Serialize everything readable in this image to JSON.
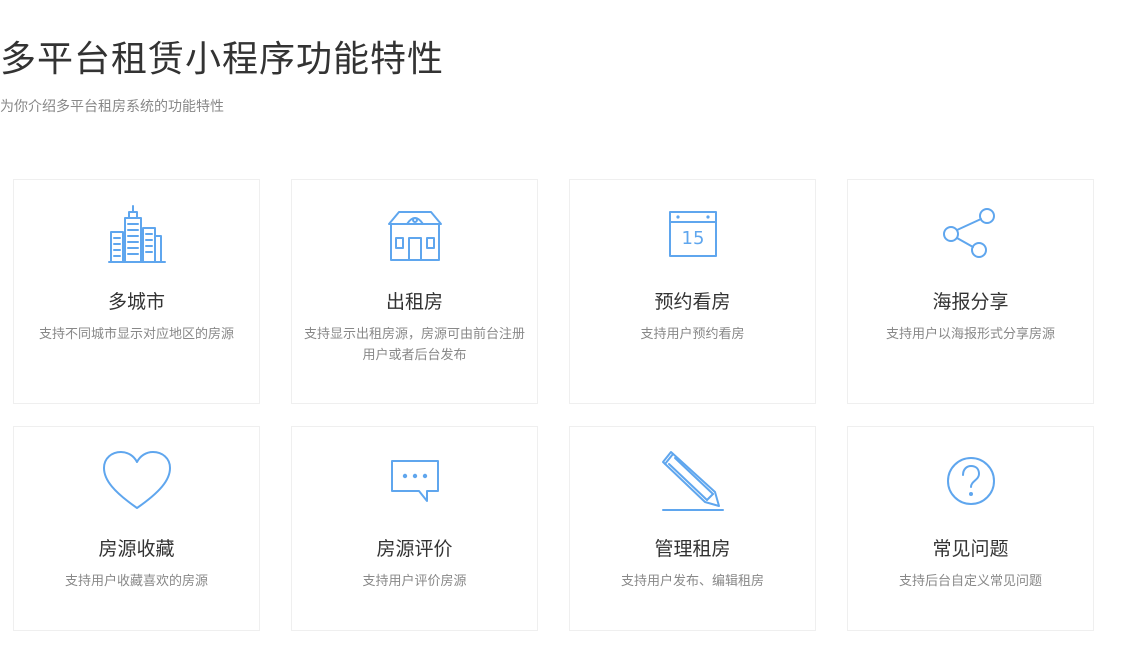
{
  "header": {
    "title": "多平台租赁小程序功能特性",
    "subtitle": "为你介绍多平台租房系统的功能特性"
  },
  "accent_color": "#5fa6ee",
  "features": [
    {
      "icon": "city-buildings-icon",
      "name": "多城市",
      "desc": "支持不同城市显示对应地区的房源"
    },
    {
      "icon": "house-icon",
      "name": "出租房",
      "desc": "支持显示出租房源，房源可由前台注册用户或者后台发布"
    },
    {
      "icon": "calendar-icon",
      "calendar_day": "15",
      "name": "预约看房",
      "desc": "支持用户预约看房"
    },
    {
      "icon": "share-icon",
      "name": "海报分享",
      "desc": "支持用户以海报形式分享房源"
    },
    {
      "icon": "heart-icon",
      "name": "房源收藏",
      "desc": "支持用户收藏喜欢的房源"
    },
    {
      "icon": "chat-bubble-icon",
      "name": "房源评价",
      "desc": "支持用户评价房源"
    },
    {
      "icon": "pencil-icon",
      "name": "管理租房",
      "desc": "支持用户发布、编辑租房"
    },
    {
      "icon": "question-icon",
      "name": "常见问题",
      "desc": "支持后台自定义常见问题"
    }
  ]
}
